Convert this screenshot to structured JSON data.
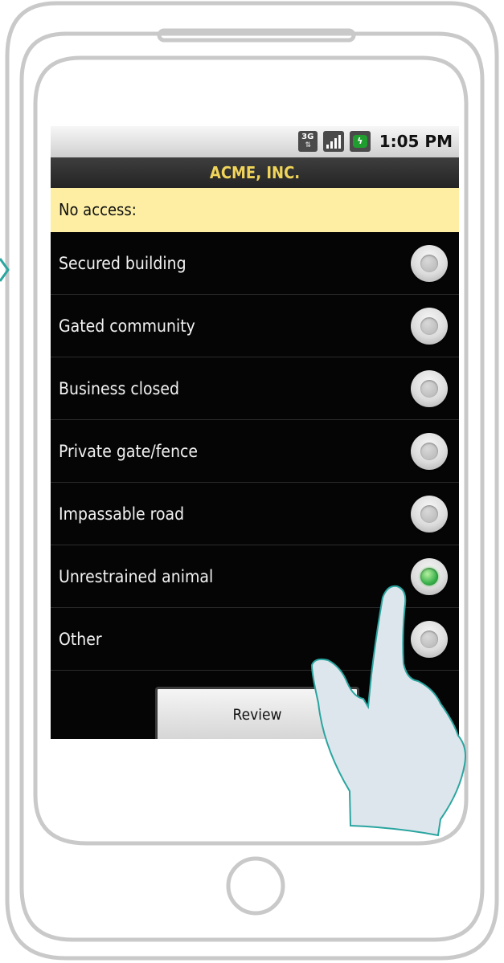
{
  "status_bar": {
    "network_icon": "3g-data-icon",
    "signal_icon": "signal-strength-icon",
    "battery_icon": "battery-charging-icon",
    "time": "1:05 PM"
  },
  "app": {
    "title": "ACME, INC."
  },
  "section": {
    "header": "No access:"
  },
  "options": [
    {
      "label": "Secured building",
      "selected": false
    },
    {
      "label": "Gated community",
      "selected": false
    },
    {
      "label": "Business closed",
      "selected": false
    },
    {
      "label": "Private gate/fence",
      "selected": false
    },
    {
      "label": "Impassable road",
      "selected": false
    },
    {
      "label": "Unrestrained animal",
      "selected": true
    },
    {
      "label": "Other",
      "selected": false
    }
  ],
  "buttons": {
    "review_label": "Review"
  },
  "colors": {
    "title_text": "#f0d45a",
    "section_bg": "#fdeea3",
    "selected_radio": "#38b04a",
    "hand_outline": "#2aa5a0",
    "hand_fill": "#dde6ec",
    "device_outline": "#c9c9c9"
  }
}
